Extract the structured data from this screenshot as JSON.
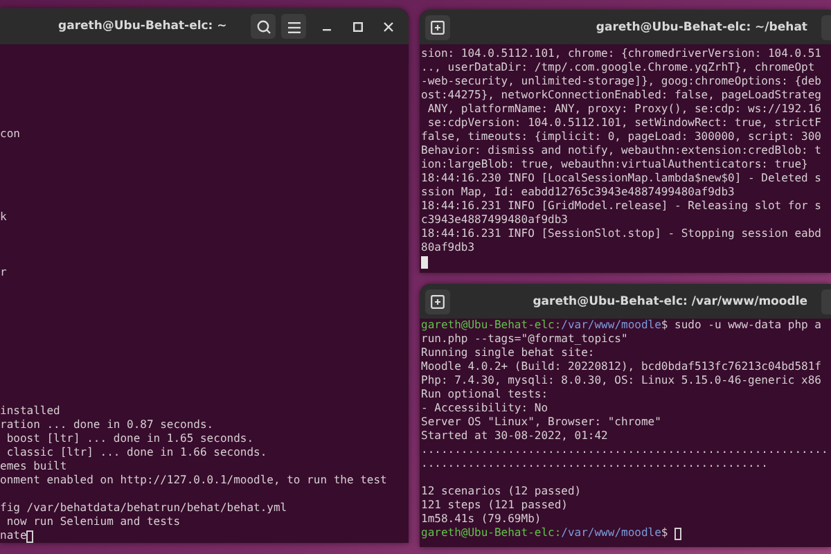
{
  "left_terminal": {
    "title": "gareth@Ubu-Behat-elc: ~",
    "lines": [
      {
        "kind": "blank"
      },
      {
        "kind": "blank"
      },
      {
        "kind": "blank"
      },
      {
        "kind": "blank"
      },
      {
        "kind": "blank"
      },
      {
        "kind": "blank"
      },
      {
        "kind": "text",
        "text": "con"
      },
      {
        "kind": "blank"
      },
      {
        "kind": "blank"
      },
      {
        "kind": "blank"
      },
      {
        "kind": "blank"
      },
      {
        "kind": "blank"
      },
      {
        "kind": "text",
        "text": "k"
      },
      {
        "kind": "blank"
      },
      {
        "kind": "blank"
      },
      {
        "kind": "blank"
      },
      {
        "kind": "text",
        "text": "r"
      },
      {
        "kind": "blank"
      },
      {
        "kind": "blank"
      },
      {
        "kind": "blank"
      },
      {
        "kind": "blank"
      },
      {
        "kind": "blank"
      },
      {
        "kind": "blank"
      },
      {
        "kind": "blank"
      },
      {
        "kind": "blank"
      },
      {
        "kind": "blank"
      },
      {
        "kind": "text",
        "text": "installed"
      },
      {
        "kind": "text",
        "text": "ration ... done in 0.87 seconds."
      },
      {
        "kind": "text",
        "text": " boost [ltr] ... done in 1.65 seconds."
      },
      {
        "kind": "text",
        "text": " classic [ltr] ... done in 1.66 seconds."
      },
      {
        "kind": "text",
        "text": "emes built"
      },
      {
        "kind": "text",
        "text": "onment enabled on http://127.0.0.1/moodle, to run the test"
      },
      {
        "kind": "blank"
      },
      {
        "kind": "text",
        "text": "fig /var/behatdata/behatrun/behat/behat.yml"
      },
      {
        "kind": "text",
        "text": " now run Selenium and tests"
      },
      {
        "kind": "text",
        "text": "nate",
        "cursor_filled": false
      }
    ]
  },
  "top_right_terminal": {
    "title": "gareth@Ubu-Behat-elc: ~/behat",
    "lines": [
      {
        "kind": "text",
        "text": "sion: 104.0.5112.101, chrome: {chromedriverVersion: 104.0.51"
      },
      {
        "kind": "text",
        "text": ".., userDataDir: /tmp/.com.google.Chrome.yqZrhT}, chromeOpt"
      },
      {
        "kind": "text",
        "text": "-web-security, unlimited-storage]}, goog:chromeOptions: {deb"
      },
      {
        "kind": "text",
        "text": "ost:44275}, networkConnectionEnabled: false, pageLoadStrateg"
      },
      {
        "kind": "text",
        "text": " ANY, platformName: ANY, proxy: Proxy(), se:cdp: ws://192.16"
      },
      {
        "kind": "text",
        "text": " se:cdpVersion: 104.0.5112.101, setWindowRect: true, strictF"
      },
      {
        "kind": "text",
        "text": "false, timeouts: {implicit: 0, pageLoad: 300000, script: 300"
      },
      {
        "kind": "text",
        "text": "Behavior: dismiss and notify, webauthn:extension:credBlob: t"
      },
      {
        "kind": "text",
        "text": "ion:largeBlob: true, webauthn:virtualAuthenticators: true}"
      },
      {
        "kind": "text",
        "text": "18:44:16.230 INFO [LocalSessionMap.lambda$new$0] - Deleted s"
      },
      {
        "kind": "text",
        "text": "ssion Map, Id: eabdd12765c3943e4887499480af9db3"
      },
      {
        "kind": "text",
        "text": "18:44:16.231 INFO [GridModel.release] - Releasing slot for s"
      },
      {
        "kind": "text",
        "text": "c3943e4887499480af9db3"
      },
      {
        "kind": "text",
        "text": "18:44:16.231 INFO [SessionSlot.stop] - Stopping session eabd"
      },
      {
        "kind": "text",
        "text": "80af9db3"
      },
      {
        "kind": "cursor",
        "cursor_filled": true
      }
    ]
  },
  "bottom_right_terminal": {
    "title": "gareth@Ubu-Behat-elc: /var/www/moodle",
    "lines": [
      {
        "kind": "prompt",
        "user": "gareth@Ubu-Behat-elc:",
        "path": "/var/www/moodle",
        "text": "$ sudo -u www-data php a"
      },
      {
        "kind": "text",
        "text": "run.php --tags=\"@format_topics\""
      },
      {
        "kind": "text",
        "text": "Running single behat site:"
      },
      {
        "kind": "text",
        "text": "Moodle 4.0.2+ (Build: 20220812), bcd0bdaf513fc76213c04bd581f"
      },
      {
        "kind": "text",
        "text": "Php: 7.4.30, mysqli: 8.0.30, OS: Linux 5.15.0-46-generic x86"
      },
      {
        "kind": "text",
        "text": "Run optional tests:"
      },
      {
        "kind": "text",
        "text": "- Accessibility: No"
      },
      {
        "kind": "text",
        "text": "Server OS \"Linux\", Browser: \"chrome\""
      },
      {
        "kind": "text",
        "text": "Started at 30-08-2022, 01:42"
      },
      {
        "kind": "text",
        "text": "............................................................."
      },
      {
        "kind": "text",
        "text": "...................................................."
      },
      {
        "kind": "blank"
      },
      {
        "kind": "text",
        "text": "12 scenarios (12 passed)"
      },
      {
        "kind": "text",
        "text": "121 steps (121 passed)"
      },
      {
        "kind": "text",
        "text": "1m58.41s (79.69Mb)"
      },
      {
        "kind": "prompt",
        "user": "gareth@Ubu-Behat-elc:",
        "path": "/var/www/moodle",
        "text": "$ ",
        "cursor_filled": false
      }
    ]
  }
}
